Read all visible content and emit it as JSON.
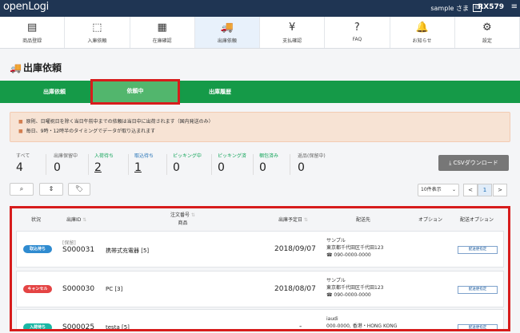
{
  "topbar": {
    "logo": "openLogi",
    "user": "sample さま",
    "id_badge": "ID",
    "account_id": "RX579",
    "menu_icon": "hamburger-icon"
  },
  "nav": [
    {
      "label": "商品登録",
      "icon": "product-register-icon"
    },
    {
      "label": "入庫依頼",
      "icon": "inbound-box-icon"
    },
    {
      "label": "在庫確認",
      "icon": "inventory-icon"
    },
    {
      "label": "出庫依頼",
      "icon": "truck-icon",
      "active": true
    },
    {
      "label": "支払確認",
      "icon": "yen-icon"
    },
    {
      "label": "FAQ",
      "icon": "question-icon"
    },
    {
      "label": "お知らせ",
      "icon": "bell-icon"
    },
    {
      "label": "設定",
      "icon": "gear-icon"
    }
  ],
  "page_title": "出庫依頼",
  "tabs": [
    "出庫依頼",
    "依頼中",
    "出庫履歴"
  ],
  "notice": [
    "原則、日曜祝日を除く当日午前中までの依頼は当日中に出荷されます（国内発送のみ）",
    "毎日、9時・12時半のタイミングでデータが取り込まれます"
  ],
  "counts": [
    {
      "label": "すべて",
      "value": "4"
    },
    {
      "label": "出庫保留中",
      "value": "0"
    },
    {
      "label": "入荷待ち",
      "value": "2"
    },
    {
      "label": "取込待ち",
      "value": "1"
    },
    {
      "label": "ピッキング中",
      "value": "0"
    },
    {
      "label": "ピッキング済",
      "value": "0"
    },
    {
      "label": "梱包済み",
      "value": "0"
    },
    {
      "label": "返品(保留中)",
      "value": "0"
    }
  ],
  "csv_button": "CSVダウンロード",
  "toolbar": {
    "search_icon": "search-icon",
    "sort_icon": "sort-icon",
    "tag_icon": "tag-icon",
    "per_page": "10件表示",
    "page_prev": "<",
    "page_current": "1",
    "page_next": ">"
  },
  "table": {
    "headers": {
      "status": "状況",
      "shipment_id": "出庫ID",
      "order_no": "注文番号",
      "product": "商品",
      "scheduled_date": "出庫予定日",
      "destination": "配送先",
      "options": "オプション",
      "delivery_options": "配送オプション"
    },
    "rows": [
      {
        "status": "取込待ち",
        "status_color": "#2f8bd0",
        "tag": "[保留]",
        "id": "S000031",
        "product": "携帯式充電器 [5]",
        "date": "2018/09/07",
        "dest_name": "サンプル",
        "dest_addr": "東京都千代田区千代田123",
        "dest_tel": "☎ 090-0000-0000",
        "button": "配送便指定"
      },
      {
        "status": "キャンセル",
        "status_color": "#e44444",
        "tag": "",
        "id": "S000030",
        "product": "PC [3]",
        "date": "2018/08/07",
        "dest_name": "サンプル",
        "dest_addr": "東京都千代田区千代田123",
        "dest_tel": "☎ 090-0000-0000",
        "button": "配送便指定"
      },
      {
        "status": "入荷待ち",
        "status_color": "#1bb7a5",
        "tag": "",
        "id": "S000025",
        "product": "testa [5]",
        "date": "-",
        "dest_name": "iaudi",
        "dest_addr": "000-0000, 香港・HONG KONG",
        "dest_tel": "",
        "button": "配送便指定"
      }
    ]
  }
}
